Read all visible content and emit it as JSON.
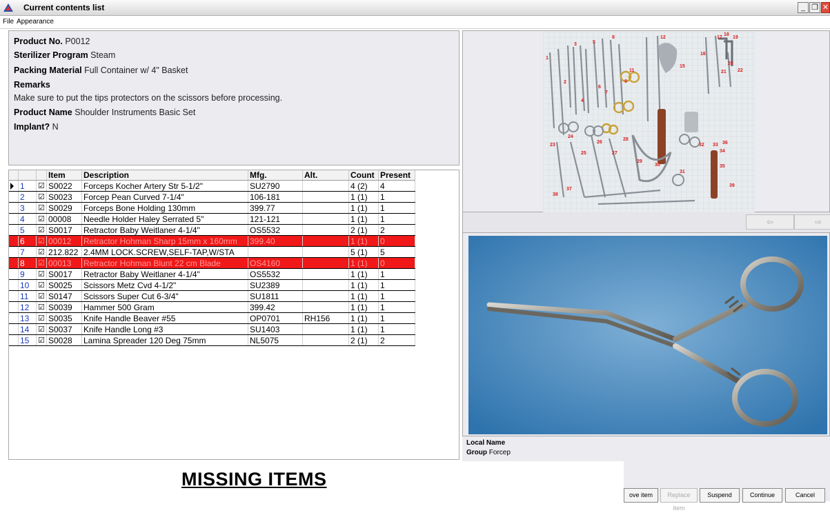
{
  "window": {
    "title": "Current contents list",
    "minimize": "_",
    "restore": "❐",
    "close": "✕"
  },
  "menu": {
    "file": "File",
    "appearance": "Appearance"
  },
  "product": {
    "product_no_label": "Product No.",
    "product_no": "P0012",
    "sterilizer_label": "Sterilizer Program",
    "sterilizer": "Steam",
    "packing_label": "Packing Material",
    "packing": "Full Container w/ 4\" Basket",
    "remarks_label": "Remarks",
    "remarks": "Make sure to put the tips protectors on the scissors before processing.",
    "name_label": "Product Name",
    "name": "Shoulder Instruments Basic Set",
    "implant_label": "Implant?",
    "implant": "N"
  },
  "grid": {
    "headers": {
      "item": "Item",
      "description": "Description",
      "mfg": "Mfg.",
      "alt": "Alt.",
      "count": "Count",
      "present": "Present"
    },
    "rows": [
      {
        "n": "1",
        "item": "S0022",
        "desc": "Forceps Kocher Artery Str 5-1/2\"",
        "mfg": "SU2790",
        "alt": "",
        "count": "4 (2)",
        "present": "4",
        "missing": false,
        "current": true
      },
      {
        "n": "2",
        "item": "S0023",
        "desc": "Forcep Pean Curved 7-1/4\"",
        "mfg": "106-181",
        "alt": "",
        "count": "1 (1)",
        "present": "1",
        "missing": false
      },
      {
        "n": "3",
        "item": "S0029",
        "desc": "Forceps Bone Holding 130mm",
        "mfg": "399.77",
        "alt": "",
        "count": "1 (1)",
        "present": "1",
        "missing": false
      },
      {
        "n": "4",
        "item": "00008",
        "desc": "Needle Holder Haley Serrated 5\"",
        "mfg": "121-121",
        "alt": "",
        "count": "1 (1)",
        "present": "1",
        "missing": false
      },
      {
        "n": "5",
        "item": "S0017",
        "desc": "Retractor Baby Weitlaner 4-1/4\"",
        "mfg": "OS5532",
        "alt": "",
        "count": "2 (1)",
        "present": "2",
        "missing": false
      },
      {
        "n": "6",
        "item": "00012",
        "desc": "Retractor Hohman Sharp 15mm x 160mm",
        "mfg": "399.40",
        "alt": "",
        "count": "1 (1)",
        "present": "0",
        "missing": true
      },
      {
        "n": "7",
        "item": "212.822",
        "desc": "2.4MM LOCK.SCREW,SELF-TAP,W/STA",
        "mfg": "",
        "alt": "",
        "count": "5 (1)",
        "present": "5",
        "missing": false
      },
      {
        "n": "8",
        "item": "00013",
        "desc": "Retractor Hohman Blunt 22 cm Blade",
        "mfg": "OS4160",
        "alt": "",
        "count": "1 (1)",
        "present": "0",
        "missing": true
      },
      {
        "n": "9",
        "item": "S0017",
        "desc": "Retractor Baby Weitlaner 4-1/4\"",
        "mfg": "OS5532",
        "alt": "",
        "count": "1 (1)",
        "present": "1",
        "missing": false
      },
      {
        "n": "10",
        "item": "S0025",
        "desc": "Scissors Metz Cvd 4-1/2\"",
        "mfg": "SU2389",
        "alt": "",
        "count": "1 (1)",
        "present": "1",
        "missing": false
      },
      {
        "n": "11",
        "item": "S0147",
        "desc": "Scissors Super Cut 6-3/4\"",
        "mfg": "SU1811",
        "alt": "",
        "count": "1 (1)",
        "present": "1",
        "missing": false
      },
      {
        "n": "12",
        "item": "S0039",
        "desc": "Hammer 500 Gram",
        "mfg": "399.42",
        "alt": "",
        "count": "1 (1)",
        "present": "1",
        "missing": false
      },
      {
        "n": "13",
        "item": "S0035",
        "desc": "Knife Handle Beaver #55",
        "mfg": "OP0701",
        "alt": "RH156",
        "count": "1 (1)",
        "present": "1",
        "missing": false
      },
      {
        "n": "14",
        "item": "S0037",
        "desc": "Knife Handle Long #3",
        "mfg": "SU1403",
        "alt": "",
        "count": "1 (1)",
        "present": "1",
        "missing": false
      },
      {
        "n": "15",
        "item": "S0028",
        "desc": "Lamina Spreader 120 Deg 75mm",
        "mfg": "NL5075",
        "alt": "",
        "count": "2 (1)",
        "present": "2",
        "missing": false
      }
    ]
  },
  "tray_labels": [
    "1",
    "2",
    "3",
    "4",
    "5",
    "6",
    "7",
    "8",
    "9",
    "11",
    "12",
    "15",
    "16",
    "17",
    "18",
    "19",
    "20",
    "21",
    "22",
    "23",
    "24",
    "25",
    "26",
    "27",
    "28",
    "29",
    "30",
    "31",
    "32",
    "33",
    "34",
    "35",
    "36",
    "37",
    "38",
    "39"
  ],
  "nav": {
    "prev_icon": "prev-arrow-icon",
    "next_icon": "next-arrow-icon",
    "prev": "⇦",
    "next": "⇨"
  },
  "details": {
    "local_name_label": "Local Name",
    "group_label": "Group",
    "group": "Forcep"
  },
  "buttons": {
    "remove": "ove item",
    "replace": "Replace item",
    "suspend": "Suspend",
    "continue": "Continue",
    "cancel": "Cancel"
  },
  "overlay": {
    "missing_items": "MISSING ITEMS"
  },
  "colors": {
    "missing_row": "#f01818",
    "row_number": "#1a3ab8"
  }
}
